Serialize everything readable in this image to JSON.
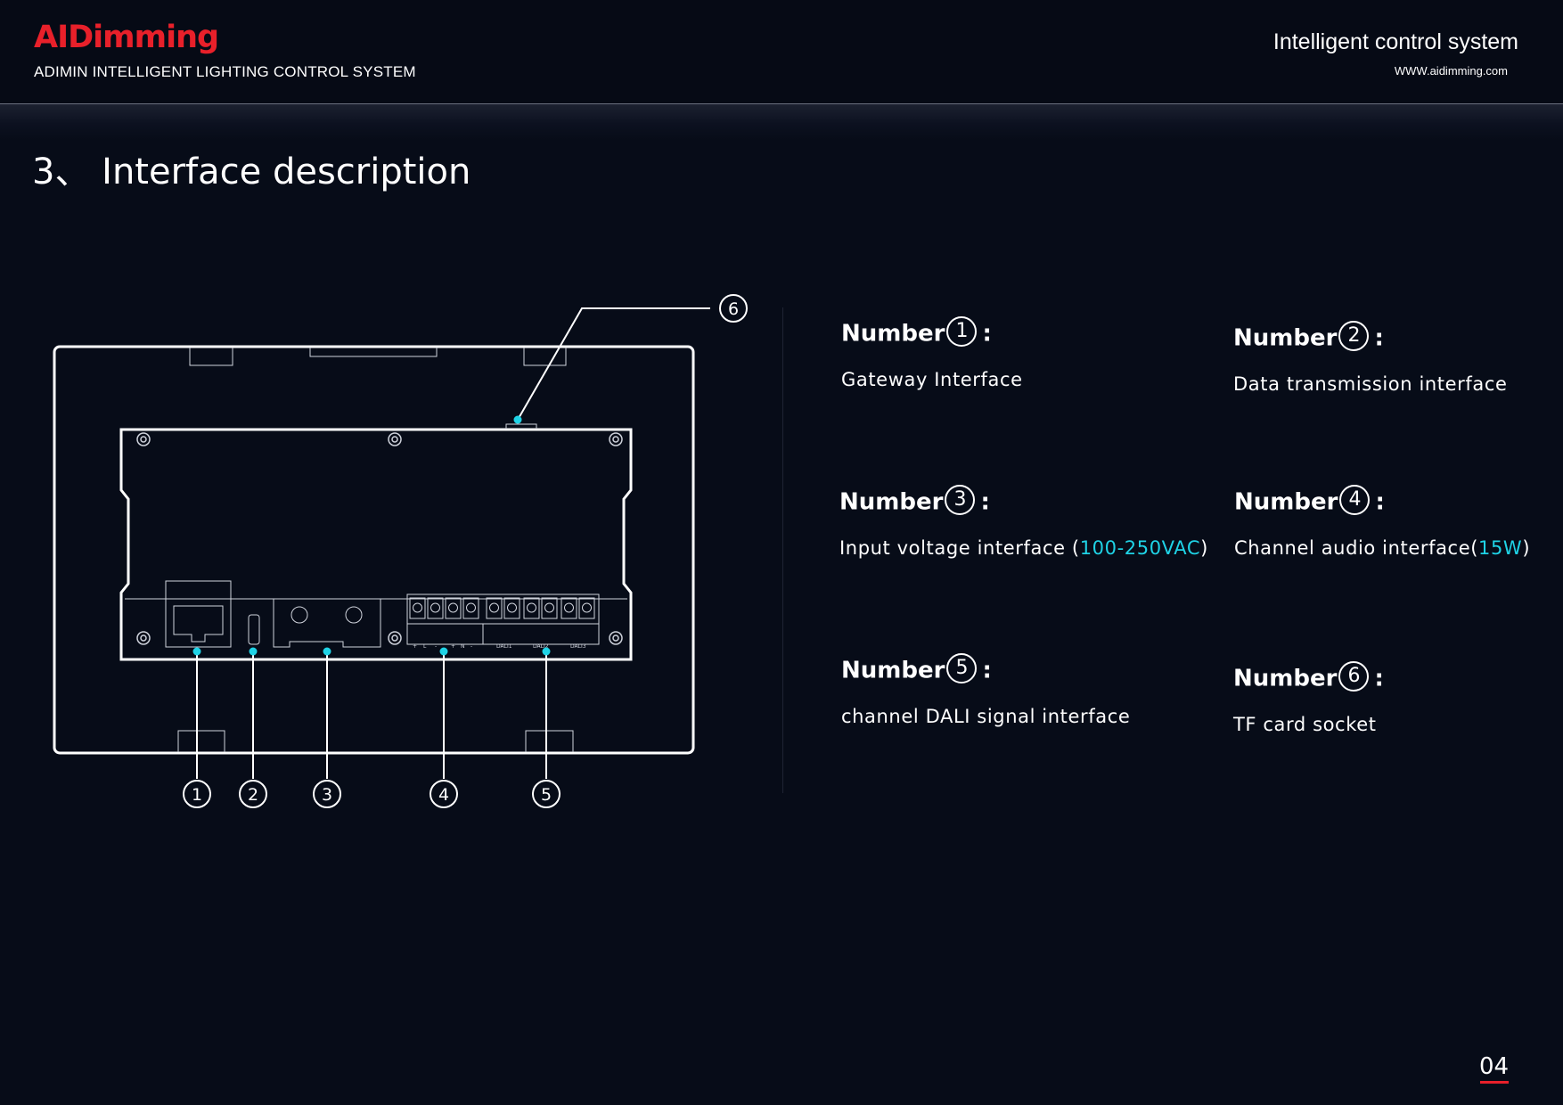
{
  "header": {
    "logo": "AIDimming",
    "subtitle": "ADIMIN INTELLIGENT LIGHTING CONTROL SYSTEM",
    "tagline": "Intelligent control system",
    "website": "WWW.aidimming.com"
  },
  "section": {
    "title": "3、 Interface description"
  },
  "diagram": {
    "callouts": [
      "1",
      "2",
      "3",
      "4",
      "5",
      "6"
    ],
    "terminal_labels": [
      "DALI1",
      "DALI2",
      "DALI3"
    ],
    "pin_labels": [
      "+",
      "L",
      "-",
      "+",
      "N",
      "-"
    ]
  },
  "items": [
    {
      "label": "Number",
      "num": "1",
      "desc": "Gateway Interface"
    },
    {
      "label": "Number",
      "num": "2",
      "desc": "Data transmission interface"
    },
    {
      "label": "Number",
      "num": "3",
      "desc_prefix": "Input voltage interface (",
      "desc_highlight": "100-250VAC",
      "desc_suffix": ")"
    },
    {
      "label": "Number",
      "num": "4",
      "desc_prefix": "Channel audio interface(",
      "desc_highlight": "15W",
      "desc_suffix": ")"
    },
    {
      "label": "Number",
      "num": "5",
      "desc": "channel DALI signal interface"
    },
    {
      "label": "Number",
      "num": "6",
      "desc": "TF card socket"
    }
  ],
  "colon": ":",
  "page_number": "04",
  "colors": {
    "accent": "#1fd3e6",
    "brand": "#e8202a",
    "background": "#070c18"
  }
}
